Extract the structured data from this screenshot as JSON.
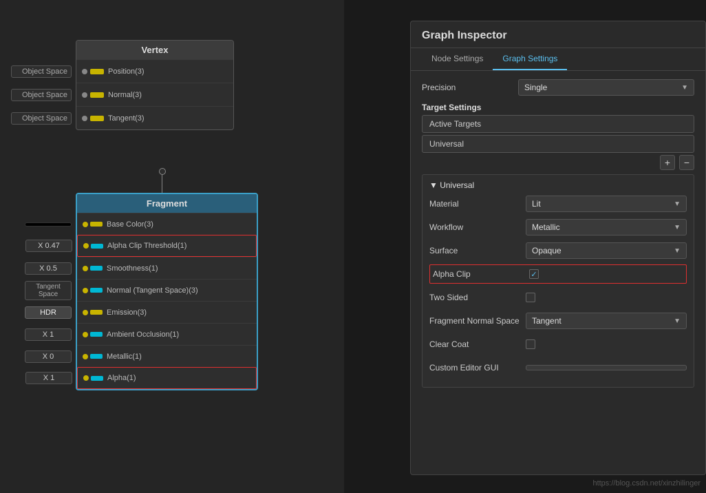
{
  "app": {
    "watermark": "https://blog.csdn.net/xinzhilinger"
  },
  "vertex_node": {
    "title": "Vertex",
    "rows": [
      {
        "label": "Object Space",
        "port": "Position(3)"
      },
      {
        "label": "Object Space",
        "port": "Normal(3)"
      },
      {
        "label": "Object Space",
        "port": "Tangent(3)"
      }
    ]
  },
  "fragment_node": {
    "title": "Fragment",
    "rows": [
      {
        "label": "",
        "label_type": "black",
        "port": "Base Color(3)"
      },
      {
        "label": "X  0.47",
        "label_type": "x",
        "port": "Alpha Clip Threshold(1)",
        "red_outline": true
      },
      {
        "label": "X  0.5",
        "label_type": "x",
        "port": "Smoothness(1)"
      },
      {
        "label": "Tangent Space",
        "label_type": "normal",
        "port": "Normal (Tangent Space)(3)"
      },
      {
        "label": "HDR",
        "label_type": "hdr",
        "port": "Emission(3)"
      },
      {
        "label": "X  1",
        "label_type": "x",
        "port": "Ambient Occlusion(1)"
      },
      {
        "label": "X  0",
        "label_type": "x",
        "port": "Metallic(1)"
      },
      {
        "label": "X  1",
        "label_type": "x",
        "port": "Alpha(1)",
        "red_outline": true
      }
    ]
  },
  "inspector": {
    "title": "Graph Inspector",
    "tabs": [
      {
        "label": "Node Settings",
        "active": false
      },
      {
        "label": "Graph Settings",
        "active": true
      }
    ],
    "precision_label": "Precision",
    "precision_value": "Single",
    "target_settings_label": "Target Settings",
    "active_targets_label": "Active Targets",
    "universal_label": "Universal",
    "add_btn": "+",
    "remove_btn": "−",
    "universal_section": {
      "header": "▼ Universal",
      "fields": [
        {
          "label": "Material",
          "value": "Lit",
          "type": "dropdown"
        },
        {
          "label": "Workflow",
          "value": "Metallic",
          "type": "dropdown"
        },
        {
          "label": "Surface",
          "value": "Opaque",
          "type": "dropdown"
        },
        {
          "label": "Alpha Clip",
          "value": "✓",
          "type": "checkbox",
          "checked": true,
          "red_outline": true
        },
        {
          "label": "Two Sided",
          "value": "",
          "type": "checkbox",
          "checked": false
        },
        {
          "label": "Fragment Normal Space",
          "value": "Tangent",
          "type": "dropdown"
        },
        {
          "label": "Clear Coat",
          "value": "",
          "type": "checkbox",
          "checked": false
        },
        {
          "label": "Custom Editor GUI",
          "value": "",
          "type": "text"
        }
      ]
    }
  }
}
